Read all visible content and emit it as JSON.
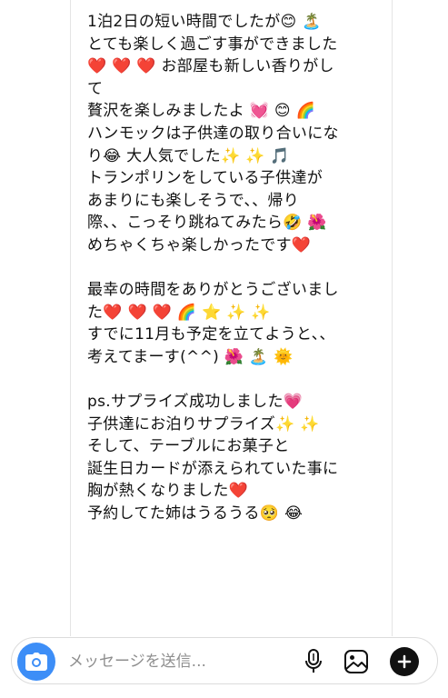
{
  "message": {
    "lines": [
      "1泊2日の短い時間でしたが😊 🏝️",
      "とても楽しく過ごす事ができました",
      "❤️ ❤️ ❤️ お部屋も新しい香りがし",
      "て",
      "贅沢を楽しみましたよ 💓 😊 🌈",
      "ハンモックは子供達の取り合いにな",
      "り😂 大人気でした✨ ✨ 🎵",
      "トランポリンをしている子供達が",
      "あまりにも楽しそうで、、帰り",
      "際、、こっそり跳ねてみたら🤣 🌺",
      "めちゃくちゃ楽しかったです❤️",
      "",
      "最幸の時間をありがとうございまし",
      "た❤️ ❤️ ❤️ 🌈 ⭐ ✨ ✨",
      "すでに11月も予定を立てようと、、",
      "考えてまーす(^^) 🌺 🏝️ 🌞",
      "",
      "ps.サプライズ成功しました💗",
      "子供達にお泊りサプライズ✨ ✨",
      "そして、テーブルにお菓子と",
      "誕生日カードが添えられていた事に",
      "胸が熱くなりました❤️",
      "予約してた姉はうるうる🥺 😂"
    ]
  },
  "composer": {
    "placeholder": "メッセージを送信...",
    "accent": "#3d8ef7"
  },
  "icons": [
    "camera-icon",
    "microphone-icon",
    "gallery-icon",
    "add-icon"
  ]
}
